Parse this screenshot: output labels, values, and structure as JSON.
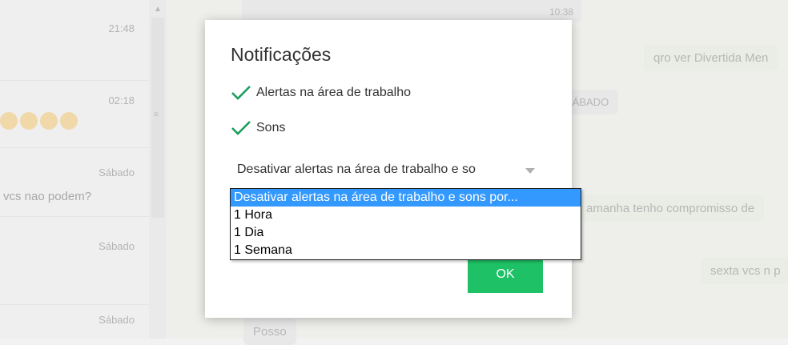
{
  "background": {
    "chat_list": [
      {
        "time": "21:48",
        "preview": ""
      },
      {
        "time": "02:18",
        "preview": ""
      },
      {
        "time": "Sábado",
        "preview": "vcs nao podem?"
      },
      {
        "time": "Sábado",
        "preview": ""
      },
      {
        "time": "Sábado",
        "preview": ""
      }
    ],
    "messages": {
      "top_time": "10:38",
      "bubble_1": "qro ver Divertida Men",
      "bubble_2": "SÁBADO",
      "bubble_3": "amanha tenho compromisso de",
      "bubble_4": "sexta vcs n p",
      "bubble_5": "Posso"
    }
  },
  "modal": {
    "title": "Notificações",
    "options": [
      {
        "label": "Alertas na área de trabalho",
        "checked": true
      },
      {
        "label": "Sons",
        "checked": true
      }
    ],
    "dropdown": {
      "selected": "Desativar alertas na área de trabalho e so",
      "options": [
        "Desativar alertas na área de trabalho e sons por...",
        "1 Hora",
        "1 Dia",
        "1 Semana"
      ]
    },
    "ok_label": "OK"
  },
  "colors": {
    "accent_green": "#1ec165",
    "check_green": "#1a9e5c",
    "selection_blue": "#3399ff"
  }
}
